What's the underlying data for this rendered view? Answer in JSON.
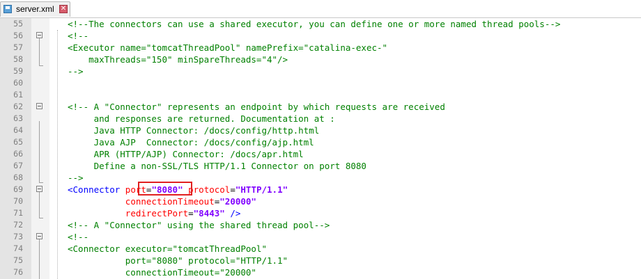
{
  "tab": {
    "label": "server.xml",
    "save_icon": "save-icon",
    "close_icon": "close-icon",
    "close_symbol": "✕"
  },
  "colors": {
    "comment": "#008000",
    "tag": "#0000ff",
    "attribute": "#ff0000",
    "value": "#8000ff",
    "highlight": "#e02020"
  },
  "lines": [
    {
      "n": "55",
      "segments": [
        {
          "t": "<!--The connectors can use a shared executor, you can define one or more named thread pools-->",
          "c": "cm"
        }
      ]
    },
    {
      "n": "56",
      "segments": [
        {
          "t": "<!--",
          "c": "cm"
        }
      ]
    },
    {
      "n": "57",
      "segments": [
        {
          "t": "<Executor name=\"tomcatThreadPool\" namePrefix=\"catalina-exec-\"",
          "c": "cm"
        }
      ]
    },
    {
      "n": "58",
      "segments": [
        {
          "t": "    maxThreads=\"150\" minSpareThreads=\"4\"/>",
          "c": "cm"
        }
      ]
    },
    {
      "n": "59",
      "segments": [
        {
          "t": "-->",
          "c": "cm"
        }
      ]
    },
    {
      "n": "60",
      "segments": []
    },
    {
      "n": "61",
      "segments": []
    },
    {
      "n": "62",
      "segments": [
        {
          "t": "<!-- A \"Connector\" represents an endpoint by which requests are received",
          "c": "cm"
        }
      ]
    },
    {
      "n": "63",
      "segments": [
        {
          "t": "     and responses are returned. Documentation at :",
          "c": "cm"
        }
      ]
    },
    {
      "n": "64",
      "segments": [
        {
          "t": "     Java HTTP Connector: /docs/config/http.html",
          "c": "cm"
        }
      ]
    },
    {
      "n": "65",
      "segments": [
        {
          "t": "     Java AJP  Connector: /docs/config/ajp.html",
          "c": "cm"
        }
      ]
    },
    {
      "n": "66",
      "segments": [
        {
          "t": "     APR (HTTP/AJP) Connector: /docs/apr.html",
          "c": "cm"
        }
      ]
    },
    {
      "n": "67",
      "segments": [
        {
          "t": "     Define a non-SSL/TLS HTTP/1.1 Connector on port 8080",
          "c": "cm"
        }
      ]
    },
    {
      "n": "68",
      "segments": [
        {
          "t": "-->",
          "c": "cm"
        }
      ]
    },
    {
      "n": "69",
      "segments": [
        {
          "t": "<Connector",
          "c": "tg"
        },
        {
          "t": " ",
          "c": "tx"
        },
        {
          "t": "port",
          "c": "at"
        },
        {
          "t": "=",
          "c": "tx"
        },
        {
          "t": "\"8080\"",
          "c": "vlb"
        },
        {
          "t": " ",
          "c": "tx"
        },
        {
          "t": "protocol",
          "c": "at"
        },
        {
          "t": "=",
          "c": "tx"
        },
        {
          "t": "\"HTTP/1.1\"",
          "c": "vlb"
        }
      ]
    },
    {
      "n": "70",
      "segments": [
        {
          "t": "           ",
          "c": "tx"
        },
        {
          "t": "connectionTimeout",
          "c": "at"
        },
        {
          "t": "=",
          "c": "tx"
        },
        {
          "t": "\"20000\"",
          "c": "vlb"
        }
      ]
    },
    {
      "n": "71",
      "segments": [
        {
          "t": "           ",
          "c": "tx"
        },
        {
          "t": "redirectPort",
          "c": "at"
        },
        {
          "t": "=",
          "c": "tx"
        },
        {
          "t": "\"8443\"",
          "c": "vlb"
        },
        {
          "t": " ",
          "c": "tx"
        },
        {
          "t": "/>",
          "c": "tg"
        }
      ]
    },
    {
      "n": "72",
      "segments": [
        {
          "t": "<!-- A \"Connector\" using the shared thread pool-->",
          "c": "cm"
        }
      ]
    },
    {
      "n": "73",
      "segments": [
        {
          "t": "<!--",
          "c": "cm"
        }
      ]
    },
    {
      "n": "74",
      "segments": [
        {
          "t": "<Connector executor=\"tomcatThreadPool\"",
          "c": "cm"
        }
      ]
    },
    {
      "n": "75",
      "segments": [
        {
          "t": "           port=\"8080\" protocol=\"HTTP/1.1\"",
          "c": "cm"
        }
      ]
    },
    {
      "n": "76",
      "segments": [
        {
          "t": "           connectionTimeout=\"20000\"",
          "c": "cm"
        }
      ]
    }
  ]
}
